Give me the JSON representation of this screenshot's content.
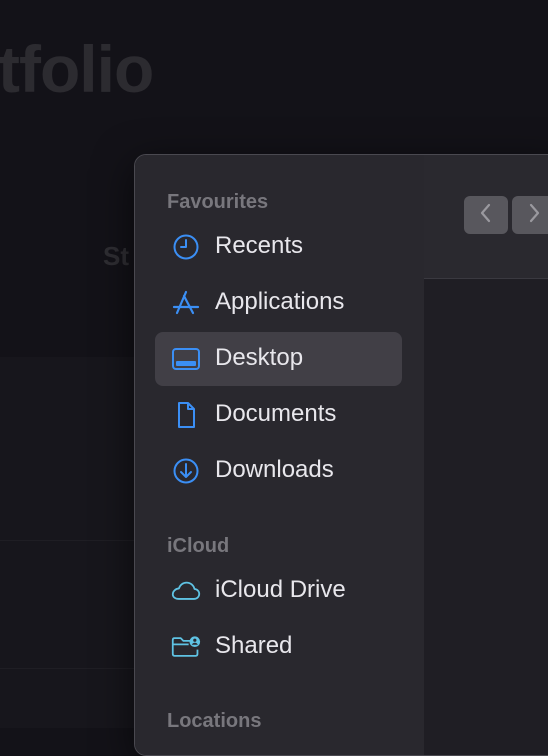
{
  "background": {
    "title": "tfolio",
    "subtitle": "St"
  },
  "dialog": {
    "sidebar": {
      "sections": [
        {
          "header": "Favourites",
          "items": [
            {
              "label": "Recents",
              "icon": "clock-icon",
              "selected": false
            },
            {
              "label": "Applications",
              "icon": "applications-icon",
              "selected": false
            },
            {
              "label": "Desktop",
              "icon": "desktop-icon",
              "selected": true
            },
            {
              "label": "Documents",
              "icon": "document-icon",
              "selected": false
            },
            {
              "label": "Downloads",
              "icon": "download-icon",
              "selected": false
            }
          ]
        },
        {
          "header": "iCloud",
          "items": [
            {
              "label": "iCloud Drive",
              "icon": "cloud-icon",
              "selected": false
            },
            {
              "label": "Shared",
              "icon": "shared-folder-icon",
              "selected": false
            }
          ]
        },
        {
          "header": "Locations",
          "items": []
        }
      ]
    },
    "toolbar": {
      "back_icon": "chevron-left-icon",
      "forward_icon": "chevron-right-icon"
    }
  },
  "colors": {
    "accent": "#3b8ff5",
    "icloud_accent": "#5fc3e4",
    "selected_bg": "#413f46",
    "label_text": "#e8e7ec",
    "section_text": "#78777d"
  }
}
